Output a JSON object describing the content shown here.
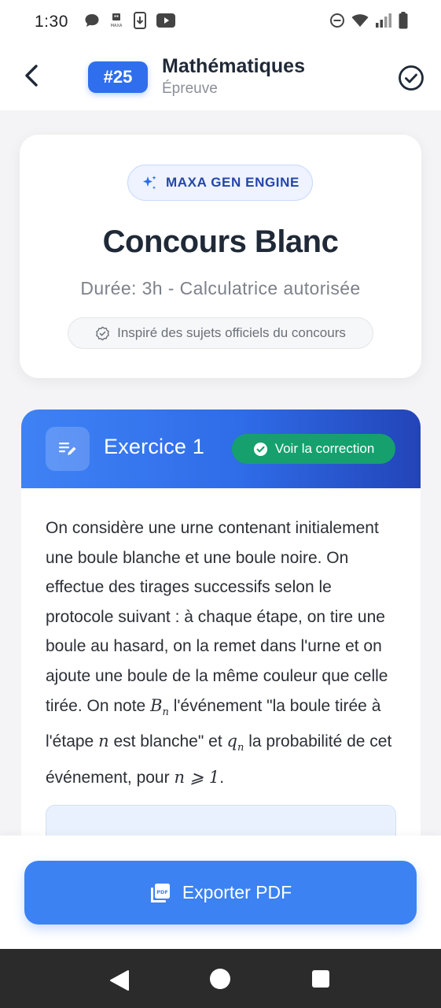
{
  "status_bar": {
    "time": "1:30",
    "left_icons": [
      "chat-bubble-icon",
      "maxa-app-icon",
      "download-icon",
      "youtube-icon"
    ],
    "maxa_icon_text": "MAXA",
    "right_icons": [
      "do-not-disturb-icon",
      "wifi-icon",
      "signal-icon",
      "battery-icon"
    ]
  },
  "header": {
    "badge": "#25",
    "title": "Mathématiques",
    "subtitle": "Épreuve"
  },
  "hero": {
    "engine_label": "MAXA GEN ENGINE",
    "title": "Concours Blanc",
    "subtitle": "Durée: 3h - Calculatrice autorisée",
    "official_label": "Inspiré des sujets officiels du concours"
  },
  "exercise": {
    "title": "Exercice 1",
    "correction_label": "Voir la correction",
    "text_1": "On considère une urne contenant initialement une boule blanche et une boule noire. On effectue des tirages successifs selon le protocole suivant : à chaque étape, on tire une boule au hasard, on la remet dans l'urne et on ajoute une boule de la même couleur que celle tirée. On note",
    "math_b": "B",
    "math_b_sub": "n",
    "text_2": "l'événement \"la boule tirée à l'étape",
    "math_n": "n",
    "text_3": "est blanche\" et",
    "math_q": "q",
    "math_q_sub": "n",
    "text_4": "la probabilité de cet événement, pour",
    "math_cond": "n ⩾ 1",
    "text_5": "."
  },
  "export": {
    "label": "Exporter PDF",
    "icon_text": "PDF"
  },
  "colors": {
    "primary": "#2f6fed",
    "success": "#16a06e",
    "export": "#3c82f3"
  }
}
